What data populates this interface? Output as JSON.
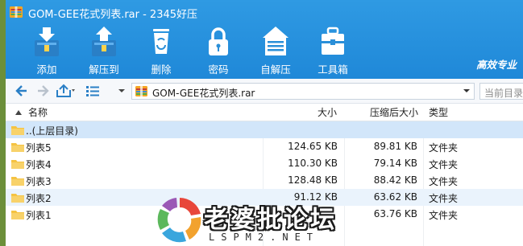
{
  "window": {
    "title": "GOM-GEE花式列表.rar - 2345好压"
  },
  "toolbar": {
    "items": [
      {
        "label": "添加",
        "icon": "add-archive-icon"
      },
      {
        "label": "解压到",
        "icon": "extract-to-icon"
      },
      {
        "label": "删除",
        "icon": "recycle-bin-icon"
      },
      {
        "label": "密码",
        "icon": "lock-icon"
      },
      {
        "label": "自解压",
        "icon": "self-extract-icon"
      },
      {
        "label": "工具箱",
        "icon": "toolbox-icon"
      }
    ],
    "slogan": "高效专业"
  },
  "nav": {
    "path": "GOM-GEE花式列表.rar",
    "search_placeholder": "当前目录查找"
  },
  "columns": {
    "name": "名称",
    "size": "大小",
    "packed": "压缩后大小",
    "type": "类型"
  },
  "rows": [
    {
      "name": "..(上层目录)",
      "size": "",
      "packed": "",
      "type": ""
    },
    {
      "name": "列表5",
      "size": "124.65 KB",
      "packed": "89.81 KB",
      "type": "文件夹"
    },
    {
      "name": "列表4",
      "size": "110.30 KB",
      "packed": "79.14 KB",
      "type": "文件夹"
    },
    {
      "name": "列表3",
      "size": "128.48 KB",
      "packed": "88.42 KB",
      "type": "文件夹"
    },
    {
      "name": "列表2",
      "size": "91.12 KB",
      "packed": "63.62 KB",
      "type": "文件夹"
    },
    {
      "name": "列表1",
      "size": "",
      "packed": "63.76 KB",
      "type": "文件夹"
    }
  ],
  "watermark": {
    "text": "老婆批论坛",
    "url": "LSPM2.NET"
  },
  "colors": {
    "toolbar": "#2193dd",
    "selected_row": "#d2e6fa",
    "folder": "#f5c342"
  }
}
